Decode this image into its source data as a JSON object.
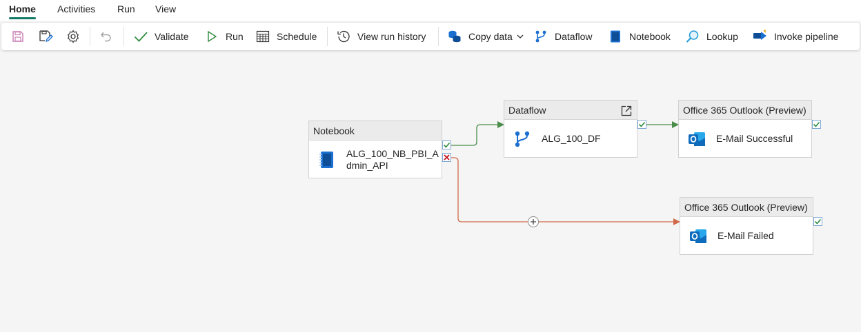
{
  "tabs": [
    {
      "label": "Home"
    },
    {
      "label": "Activities"
    },
    {
      "label": "Run"
    },
    {
      "label": "View"
    }
  ],
  "toolbar": {
    "validate": "Validate",
    "run": "Run",
    "schedule": "Schedule",
    "view_run_history": "View run history",
    "copy_data": "Copy data",
    "dataflow": "Dataflow",
    "notebook": "Notebook",
    "lookup": "Lookup",
    "invoke_pipeline": "Invoke pipeline"
  },
  "activities": {
    "notebook": {
      "type": "Notebook",
      "name_line1": "ALG_100_NB_PBI_A",
      "name_line2": "dmin_API"
    },
    "dataflow": {
      "type": "Dataflow",
      "name": "ALG_100_DF"
    },
    "outlook_success": {
      "type": "Office 365 Outlook (Preview)",
      "name": "E-Mail Successful"
    },
    "outlook_failed": {
      "type": "Office 365 Outlook (Preview)",
      "name": "E-Mail Failed"
    }
  },
  "colors": {
    "accent": "#117865",
    "success_wire": "#4a8d4a",
    "failure_wire": "#d0694a",
    "notebook_blue": "#1a6fd1",
    "outlook_blue": "#0f6cbd"
  }
}
